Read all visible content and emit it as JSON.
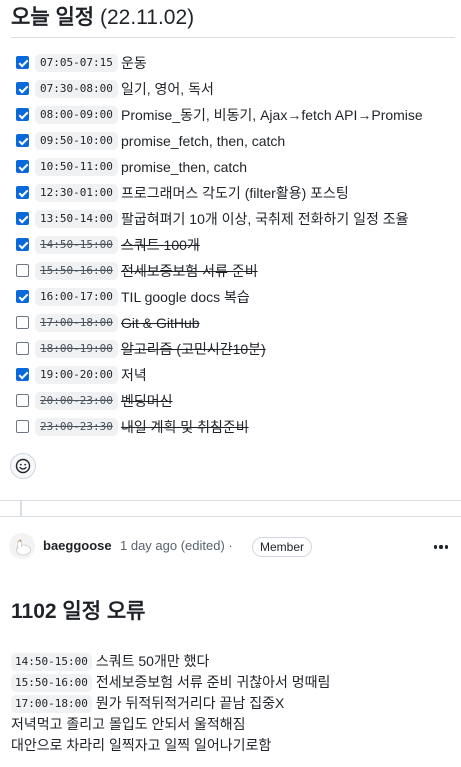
{
  "header": {
    "title": "오늘 일정",
    "date": "(22.11.02)"
  },
  "tasks": [
    {
      "time": "07:05-07:15",
      "label": "운동",
      "checked": true,
      "struck": false
    },
    {
      "time": "07:30-08:00",
      "label": "일기, 영어, 독서",
      "checked": true,
      "struck": false
    },
    {
      "time": "08:00-09:00",
      "label": "Promise_동기, 비동기, Ajax→fetch API→Promise",
      "checked": true,
      "struck": false
    },
    {
      "time": "09:50-10:00",
      "label": "promise_fetch, then, catch",
      "checked": true,
      "struck": false
    },
    {
      "time": "10:50-11:00",
      "label": "promise_then, catch",
      "checked": true,
      "struck": false
    },
    {
      "time": "12:30-01:00",
      "label": "프로그래머스 각도기 (filter활용) 포스팅",
      "checked": true,
      "struck": false
    },
    {
      "time": "13:50-14:00",
      "label": "팔굽혀펴기 10개 이상, 국취제 전화하기 일정 조율",
      "checked": true,
      "struck": false
    },
    {
      "time": "14:50-15:00",
      "label": "스쿼트 100개",
      "checked": true,
      "struck": true
    },
    {
      "time": "15:50-16:00",
      "label": "전세보증보험 서류 준비",
      "checked": false,
      "struck": true
    },
    {
      "time": "16:00-17:00",
      "label": "TIL google docs 복습",
      "checked": true,
      "struck": false
    },
    {
      "time": "17:00-18:00",
      "label": "Git & GitHub",
      "checked": false,
      "struck": true
    },
    {
      "time": "18:00-19:00",
      "label": "알고리즘 (고민시간10분)",
      "checked": false,
      "struck": true
    },
    {
      "time": "19:00-20:00",
      "label": "저녁",
      "checked": true,
      "struck": false
    },
    {
      "time": "20:00-23:00",
      "label": "벤딩머신",
      "checked": false,
      "struck": true
    },
    {
      "time": "23:00-23:30",
      "label": "내일 계획 및 취침준비",
      "checked": false,
      "struck": true
    }
  ],
  "reaction": {
    "icon": "smiley-icon"
  },
  "comment": {
    "author": "baeggoose",
    "meta": "1 day ago (edited)",
    "separator": "·",
    "role": "Member",
    "title": "1102 일정 오류",
    "notes": [
      {
        "time": "14:50-15:00",
        "text": "스쿼트 50개만 했다"
      },
      {
        "time": "15:50-16:00",
        "text": "전세보증보험 서류 준비 귀찮아서 멍때림"
      },
      {
        "time": "17:00-18:00",
        "text": "뭔가 뒤적뒤적거리다 끝남 집중X"
      },
      {
        "time": "",
        "text": "저녁먹고 졸리고 몰입도 안되서 울적해짐"
      },
      {
        "time": "",
        "text": "대안으로 차라리 일찍자고 일찍 일어나기로함"
      }
    ]
  },
  "colors": {
    "accent": "#0969da",
    "border": "#d0d7de",
    "code_bg": "#eff1f3"
  }
}
